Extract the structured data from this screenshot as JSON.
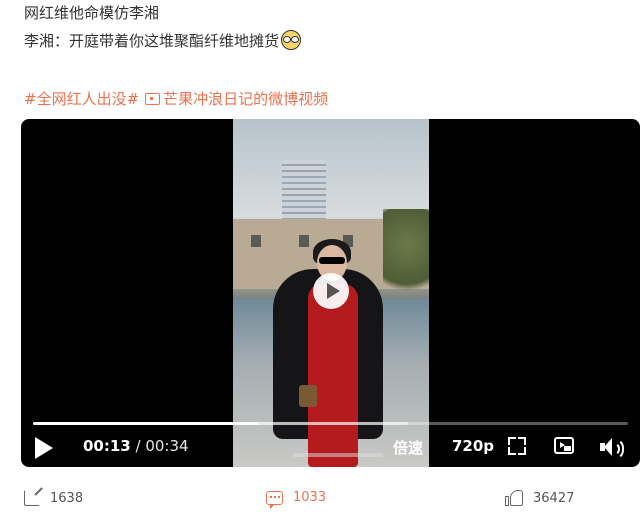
{
  "post": {
    "line1": "网红维他命模仿李湘",
    "line2": "李湘：开庭带着你这堆聚酯纤维地摊货",
    "topic": "#全网红人出没#",
    "video_link": "芒果冲浪日记的微博视频"
  },
  "player": {
    "current_time": "00:13",
    "separator": " / ",
    "total_time": "00:34",
    "progress_fraction": 0.38,
    "buffered_fraction": 0.63,
    "speed_label": "倍速",
    "quality_label": "720p"
  },
  "actions": {
    "shares": "1638",
    "comments": "1033",
    "likes": "36427"
  },
  "icons": {
    "emoji": "glasses-face-icon",
    "link": "video-link-icon",
    "play": "play-icon",
    "fullscreen": "fullscreen-icon",
    "pip": "picture-in-picture-icon",
    "volume": "volume-icon",
    "share": "share-icon",
    "comment": "comment-icon",
    "like": "like-icon"
  },
  "colors": {
    "accent": "#eb7350",
    "text": "#333333",
    "player_bg": "#000000"
  }
}
